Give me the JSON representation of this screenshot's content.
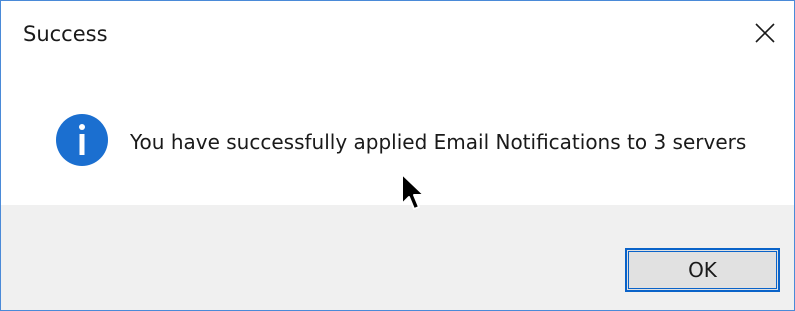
{
  "dialog": {
    "title": "Success",
    "close_icon": "close-icon",
    "message": "You have successfully applied Email Notifications to 3 servers",
    "icon": "information-icon",
    "ok_label": "OK"
  },
  "colors": {
    "window_border": "#4a8ad8",
    "info_icon": "#1b6fd0",
    "footer_bg": "#f0f0f0",
    "button_focus_border": "#0a63c9"
  }
}
